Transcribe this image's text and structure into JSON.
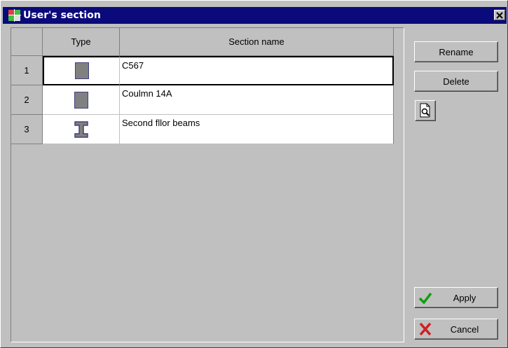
{
  "window": {
    "title": "User's section",
    "close_glyph": "×",
    "icon": "app-grid-icon"
  },
  "table": {
    "headers": {
      "num": "",
      "type": "Type",
      "name": "Section name"
    },
    "rows": [
      {
        "num": "1",
        "type_icon": "rectangle-section-icon",
        "name": "C567",
        "selected": true
      },
      {
        "num": "2",
        "type_icon": "rectangle-section-icon",
        "name": "Coulmn 14A",
        "selected": false
      },
      {
        "num": "3",
        "type_icon": "i-beam-section-icon",
        "name": "Second fllor beams",
        "selected": false
      }
    ]
  },
  "buttons": {
    "rename": "Rename",
    "delete": "Delete",
    "preview_icon": "preview-document-icon",
    "apply": "Apply",
    "apply_icon": "checkmark-icon",
    "cancel": "Cancel",
    "cancel_icon": "x-icon"
  },
  "colors": {
    "titlebar": "#0a0a7a",
    "check": "#10a010",
    "cancel": "#d02020",
    "section_fill": "#808080",
    "section_outline": "#404080"
  }
}
